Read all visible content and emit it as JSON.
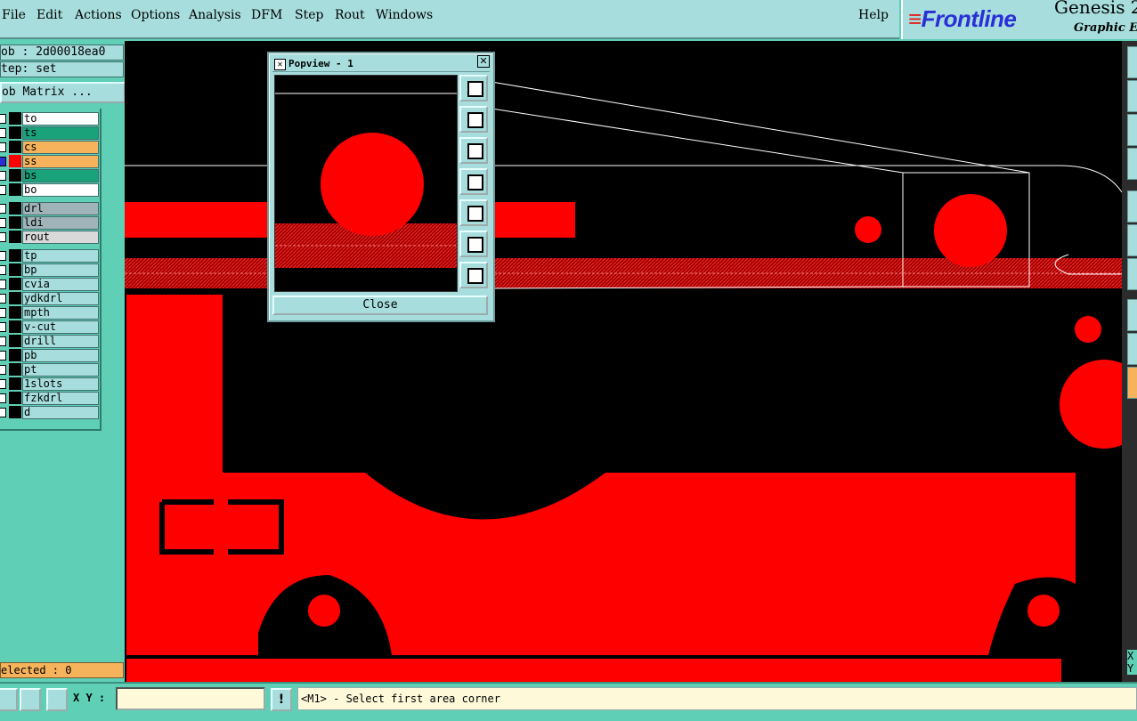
{
  "menubar": {
    "items": [
      "File",
      "Edit",
      "Actions",
      "Options",
      "Analysis",
      "DFM",
      "Step",
      "Rout",
      "Windows"
    ],
    "help": "Help"
  },
  "brand": {
    "logo": "Frontline",
    "title": "Genesis 2",
    "subtitle": "Graphic Edi"
  },
  "job_panel": {
    "job": "ob : 2d00018ea0",
    "step": "tep: set",
    "job_matrix": "ob Matrix ..."
  },
  "layers": [
    {
      "name": "to",
      "bg": "#ffffff",
      "color": "#000000"
    },
    {
      "name": "ts",
      "bg": "#1aa37a",
      "color": "#000000"
    },
    {
      "name": "cs",
      "bg": "#f6b35b",
      "color": "#000000"
    },
    {
      "name": "ss",
      "bg": "#f6b35b",
      "color": "#ff0000",
      "active": true
    },
    {
      "name": "bs",
      "bg": "#1aa37a",
      "color": "#000000"
    },
    {
      "name": "bo",
      "bg": "#ffffff",
      "color": "#000000"
    },
    {
      "name": "drl",
      "bg": "#9fb3b8",
      "color": "#000000"
    },
    {
      "name": "ldi",
      "bg": "#9fb3b8",
      "color": "#000000"
    },
    {
      "name": "rout",
      "bg": "#d9d9d9",
      "color": "#000000"
    },
    {
      "name": "tp",
      "bg": "#a7dedd",
      "color": "#000000"
    },
    {
      "name": "bp",
      "bg": "#a7dedd",
      "color": "#000000"
    },
    {
      "name": "cvia",
      "bg": "#a7dedd",
      "color": "#000000"
    },
    {
      "name": "ydkdrl",
      "bg": "#a7dedd",
      "color": "#000000"
    },
    {
      "name": "mpth",
      "bg": "#a7dedd",
      "color": "#000000"
    },
    {
      "name": "v-cut",
      "bg": "#a7dedd",
      "color": "#000000"
    },
    {
      "name": "drill",
      "bg": "#a7dedd",
      "color": "#000000"
    },
    {
      "name": "pb",
      "bg": "#a7dedd",
      "color": "#000000"
    },
    {
      "name": "pt",
      "bg": "#a7dedd",
      "color": "#000000"
    },
    {
      "name": "1slots",
      "bg": "#a7dedd",
      "color": "#000000"
    },
    {
      "name": "fzkdrl",
      "bg": "#a7dedd",
      "color": "#000000"
    },
    {
      "name": "d",
      "bg": "#a7dedd",
      "color": "#000000"
    }
  ],
  "selected": "elected : 0",
  "popview": {
    "title": "Popview - 1",
    "close": "Close",
    "buttons": [
      "zoom-window-icon",
      "pan-up-icon",
      "pan-down-icon",
      "pan-left-icon",
      "pan-right-icon",
      "zoom-in-icon",
      "zoom-out-icon"
    ]
  },
  "statusbar": {
    "xy_label": "X Y :",
    "xy_value": "",
    "warn": "!",
    "message": "<M1> - Select first area corner"
  },
  "right_strip": {
    "x": "X",
    "y": "Y"
  },
  "colors": {
    "copper": "#ff0000",
    "background": "#000000",
    "panel": "#a7dedd",
    "frame": "#5fcfb6"
  }
}
